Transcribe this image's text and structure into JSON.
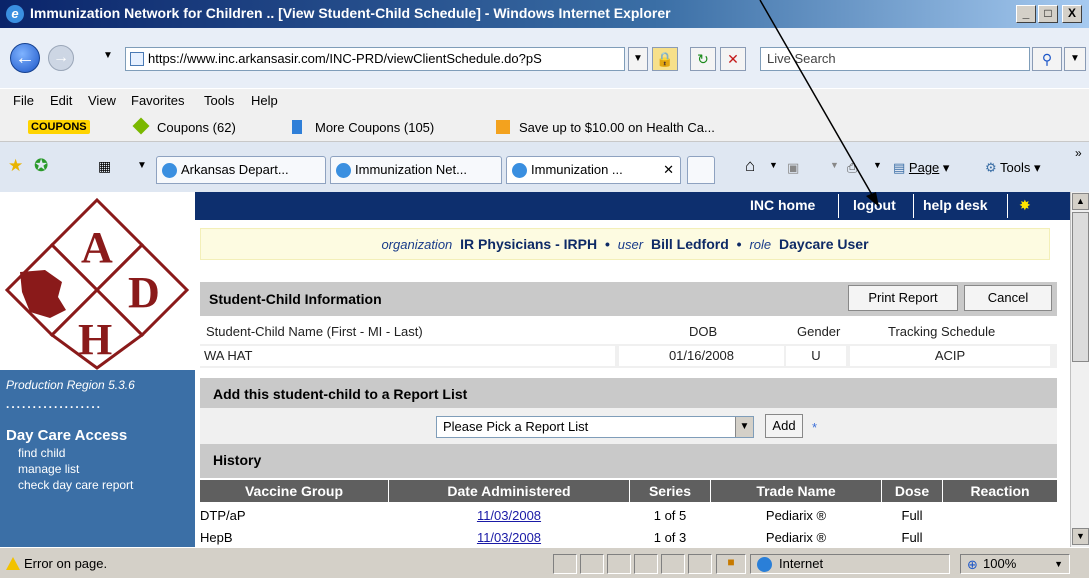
{
  "window": {
    "title": "Immunization Network for Children .. [View Student-Child Schedule] - Windows Internet Explorer",
    "minimize": "_",
    "maximize": "□",
    "close": "X"
  },
  "address": {
    "url": "https://www.inc.arkansasir.com/INC-PRD/viewClientSchedule.do?pS",
    "search_placeholder": "Live Search"
  },
  "menu": [
    "File",
    "Edit",
    "View",
    "Favorites",
    "Tools",
    "Help"
  ],
  "coupon_bar": {
    "logo": "COUPONS",
    "coupons": "Coupons (62)",
    "more_coupons": "More Coupons (105)",
    "save": "Save up to $10.00 on Health Ca..."
  },
  "tabs": [
    {
      "label": "Arkansas Depart..."
    },
    {
      "label": "Immunization Net..."
    },
    {
      "label": "Immunization ..."
    }
  ],
  "tab_tools": {
    "page": "Page",
    "tools": "Tools"
  },
  "sidebar": {
    "region": "Production Region 5.3.6",
    "dots": "..................",
    "heading": "Day Care Access",
    "links": [
      "find child",
      "manage list",
      "check day care report"
    ]
  },
  "topnav": {
    "home": "INC home",
    "logout": "logout",
    "help": "help desk"
  },
  "userinfo": {
    "org_label": "organization",
    "org": "IR Physicians - IRPH",
    "user_label": "user",
    "user": "Bill Ledford",
    "role_label": "role",
    "role": "Daycare User",
    "bullet": "•"
  },
  "student_info": {
    "title": "Student-Child Information",
    "print": "Print Report",
    "cancel": "Cancel",
    "headers": [
      "Student-Child Name (First - MI - Last)",
      "DOB",
      "Gender",
      "Tracking Schedule"
    ],
    "values": [
      "WA HAT",
      "01/16/2008",
      "U",
      "ACIP"
    ]
  },
  "report_list": {
    "title": "Add this student-child to a Report List",
    "select": "Please Pick a Report List",
    "add": "Add",
    "asterisk": "*"
  },
  "history": {
    "title": "History",
    "headers": [
      "Vaccine Group",
      "Date Administered",
      "Series",
      "Trade Name",
      "Dose",
      "Reaction"
    ],
    "rows": [
      [
        "DTP/aP",
        "11/03/2008",
        "1 of 5",
        "Pediarix ®",
        "Full",
        ""
      ],
      [
        "HepB",
        "11/03/2008",
        "1 of 3",
        "Pediarix ®",
        "Full",
        ""
      ]
    ]
  },
  "status": {
    "text": "Error on page.",
    "zone": "Internet",
    "zoom": "100%"
  }
}
